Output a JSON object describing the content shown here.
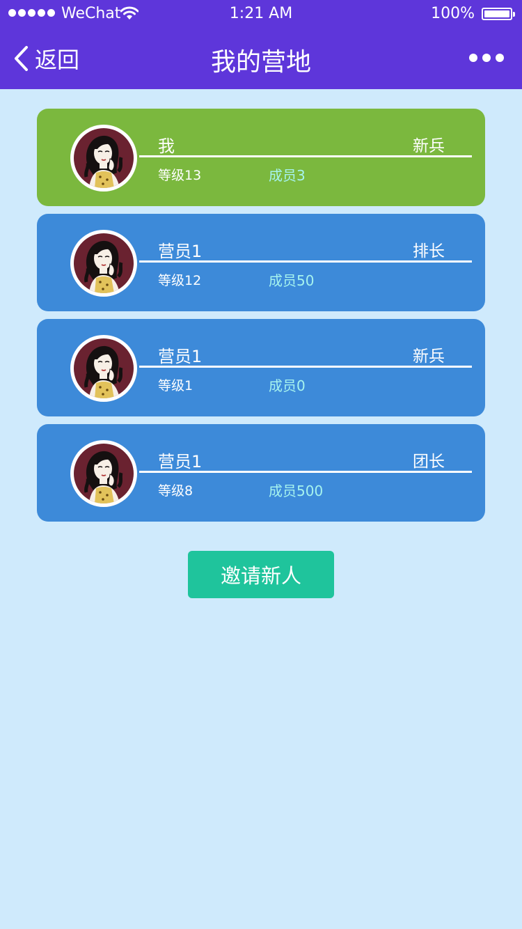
{
  "status_bar": {
    "carrier": "WeChat",
    "time": "1:21 AM",
    "battery": "100%",
    "signal_icon": "signal-dots-icon",
    "wifi_icon": "wifi-icon",
    "battery_icon": "battery-icon"
  },
  "nav": {
    "back_label": "返回",
    "back_icon": "chevron-left-icon",
    "title": "我的营地",
    "more_icon": "more-dots-icon"
  },
  "colors": {
    "header": "#5e36da",
    "background": "#cfeafc",
    "card_self": "#7bb83e",
    "card_member": "#3d8ad9",
    "members_text": "#a6f3ee",
    "invite_button": "#1fc49c"
  },
  "members": [
    {
      "name": "我",
      "rank": "新兵",
      "level": "等级13",
      "count": "成员3",
      "color": "#7bb83e"
    },
    {
      "name": "营员1",
      "rank": "排长",
      "level": "等级12",
      "count": "成员50",
      "color": "#3d8ad9"
    },
    {
      "name": "营员1",
      "rank": "新兵",
      "level": "等级1",
      "count": "成员0",
      "color": "#3d8ad9"
    },
    {
      "name": "营员1",
      "rank": "团长",
      "level": "等级8",
      "count": "成员500",
      "color": "#3d8ad9"
    }
  ],
  "invite": {
    "label": "邀请新人"
  }
}
